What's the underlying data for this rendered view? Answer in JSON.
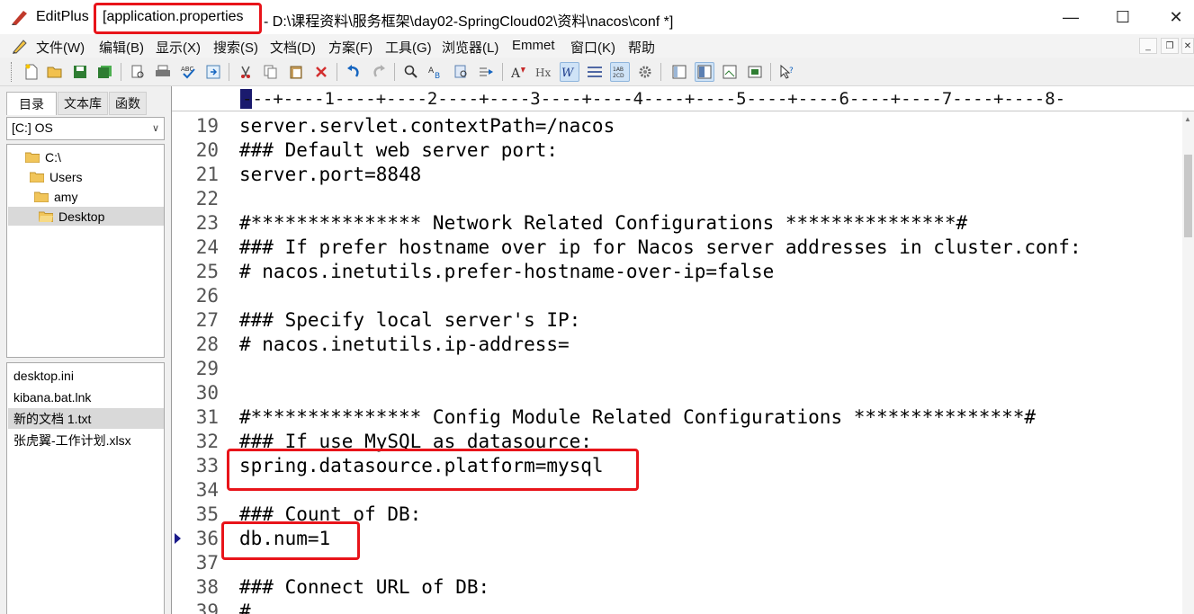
{
  "window": {
    "app_name": "EditPlus",
    "file_title": "[application.properties",
    "path_title": "- D:\\课程资料\\服务框架\\day02-SpringCloud02\\资料\\nacos\\conf *]",
    "minimize": "—",
    "maximize": "☐",
    "close": "✕"
  },
  "menu": {
    "items": [
      "文件(W)",
      "编辑(B)",
      "显示(X)",
      "搜索(S)",
      "文档(D)",
      "方案(F)",
      "工具(G)",
      "浏览器(L)",
      "Emmet",
      "窗口(K)",
      "帮助"
    ],
    "mdi_min": "_",
    "mdi_restore": "❐",
    "mdi_close": "✕"
  },
  "left_pane": {
    "tabs": [
      "目录",
      "文本库",
      "函数"
    ],
    "drive": "[C:] OS",
    "tree": [
      "C:\\",
      "Users",
      "amy",
      "Desktop"
    ],
    "files": [
      "desktop.ini",
      "kibana.bat.lnk",
      "新的文档 1.txt",
      "张虎翼-工作计划.xlsx"
    ]
  },
  "ruler": {
    "text": "---+----1----+----2----+----3----+----4----+----5----+----6----+----7----+----8-"
  },
  "editor": {
    "lines": [
      {
        "num": "19",
        "text": "server.servlet.contextPath=/nacos"
      },
      {
        "num": "20",
        "text": "### Default web server port:"
      },
      {
        "num": "21",
        "text": "server.port=8848"
      },
      {
        "num": "22",
        "text": ""
      },
      {
        "num": "23",
        "text": "#*************** Network Related Configurations ***************#"
      },
      {
        "num": "24",
        "text": "### If prefer hostname over ip for Nacos server addresses in cluster.conf:"
      },
      {
        "num": "25",
        "text": "# nacos.inetutils.prefer-hostname-over-ip=false"
      },
      {
        "num": "26",
        "text": ""
      },
      {
        "num": "27",
        "text": "### Specify local server's IP:"
      },
      {
        "num": "28",
        "text": "# nacos.inetutils.ip-address="
      },
      {
        "num": "29",
        "text": ""
      },
      {
        "num": "30",
        "text": ""
      },
      {
        "num": "31",
        "text": "#*************** Config Module Related Configurations ***************#"
      },
      {
        "num": "32",
        "text": "### If use MySQL as datasource:"
      },
      {
        "num": "33",
        "text": "spring.datasource.platform=mysql"
      },
      {
        "num": "34",
        "text": ""
      },
      {
        "num": "35",
        "text": "### Count of DB:"
      },
      {
        "num": "36",
        "text": "db.num=1"
      },
      {
        "num": "37",
        "text": ""
      },
      {
        "num": "38",
        "text": "### Connect URL of DB:"
      },
      {
        "num": "39",
        "text": "#"
      }
    ]
  },
  "colors": {
    "highlight": "#e8141a",
    "caret": "#1a1a6e"
  }
}
